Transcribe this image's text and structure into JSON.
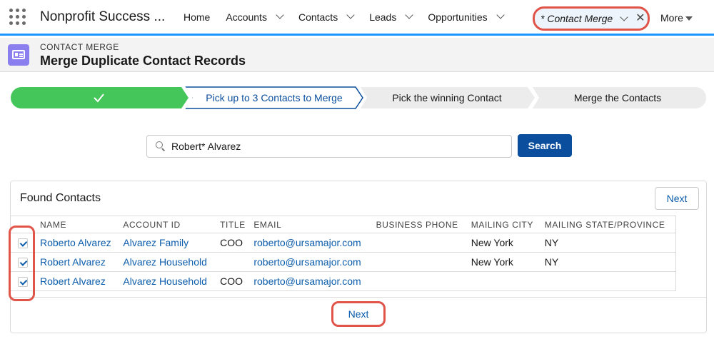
{
  "nav": {
    "app_name": "Nonprofit Success ...",
    "items": [
      {
        "label": "Home",
        "has_menu": false
      },
      {
        "label": "Accounts",
        "has_menu": true
      },
      {
        "label": "Contacts",
        "has_menu": true
      },
      {
        "label": "Leads",
        "has_menu": true
      },
      {
        "label": "Opportunities",
        "has_menu": true
      }
    ],
    "active_tab": {
      "label": "* Contact Merge"
    },
    "more_label": "More"
  },
  "header": {
    "kicker": "CONTACT MERGE",
    "title": "Merge Duplicate Contact Records"
  },
  "path": {
    "steps": [
      {
        "label": "",
        "state": "complete"
      },
      {
        "label": "Pick up to 3 Contacts to Merge",
        "state": "current"
      },
      {
        "label": "Pick the winning Contact",
        "state": "incomplete"
      },
      {
        "label": "Merge the Contacts",
        "state": "incomplete"
      }
    ]
  },
  "search": {
    "value": "Robert* Alvarez",
    "button_label": "Search"
  },
  "results": {
    "title": "Found Contacts",
    "next_top_label": "Next",
    "next_bottom_label": "Next",
    "columns": [
      "NAME",
      "ACCOUNT ID",
      "TITLE",
      "EMAIL",
      "BUSINESS PHONE",
      "MAILING CITY",
      "MAILING STATE/PROVINCE"
    ],
    "rows": [
      {
        "checked": true,
        "name": "Roberto Alvarez",
        "account": "Alvarez Family",
        "title": "COO",
        "email": "roberto@ursamajor.com",
        "phone": "",
        "city": "New York",
        "state": "NY"
      },
      {
        "checked": true,
        "name": "Robert Alvarez",
        "account": "Alvarez Household",
        "title": "",
        "email": "roberto@ursamajor.com",
        "phone": "",
        "city": "New York",
        "state": "NY"
      },
      {
        "checked": true,
        "name": "Robert Alvarez",
        "account": "Alvarez Household",
        "title": "COO",
        "email": "roberto@ursamajor.com",
        "phone": "",
        "city": "",
        "state": ""
      }
    ]
  },
  "colors": {
    "accent": "#1b96ff",
    "path_complete": "#45c65a",
    "path_current_border": "#0b4e9d",
    "path_incomplete": "#ececec",
    "button_brand": "#0b4e9d",
    "highlight": "#e0544a",
    "link": "#0b5cab",
    "header_icon": "#8b7ff0"
  }
}
